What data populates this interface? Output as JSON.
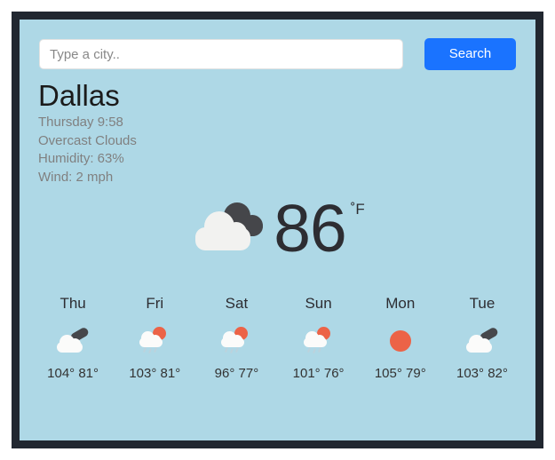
{
  "app": {
    "background_color": "#aed8e6",
    "border_color": "#212730"
  },
  "search": {
    "placeholder": "Type a city..",
    "value": "",
    "button_label": "Search",
    "button_color": "#1a73ff"
  },
  "current": {
    "city": "Dallas",
    "day_time": "Thursday 9:58",
    "condition": "Overcast Clouds",
    "humidity": "Humidity: 63%",
    "wind": "Wind: 2 mph",
    "temperature": "86",
    "unit": "˚F",
    "icon": "overcast-clouds-icon"
  },
  "forecast": [
    {
      "day": "Thu",
      "icon": "cloudy-icon",
      "temps": "104° 81°",
      "high": "104°",
      "low": "81°"
    },
    {
      "day": "Fri",
      "icon": "sun-rain-icon",
      "temps": "103° 81°",
      "high": "103°",
      "low": "81°"
    },
    {
      "day": "Sat",
      "icon": "sun-rain-icon",
      "temps": "96° 77°",
      "high": "96°",
      "low": "77°"
    },
    {
      "day": "Sun",
      "icon": "sun-rain-icon",
      "temps": "101° 76°",
      "high": "101°",
      "low": "76°"
    },
    {
      "day": "Mon",
      "icon": "clear-sun-icon",
      "temps": "105° 79°",
      "high": "105°",
      "low": "79°"
    },
    {
      "day": "Tue",
      "icon": "cloudy-icon",
      "temps": "103° 82°",
      "high": "103°",
      "low": "82°"
    }
  ],
  "colors": {
    "sun": "#ec6347",
    "cloud_light": "#fbfbfa",
    "cloud_dark": "#46474b",
    "text_dark": "#2d2d32",
    "text_muted": "#808080"
  }
}
